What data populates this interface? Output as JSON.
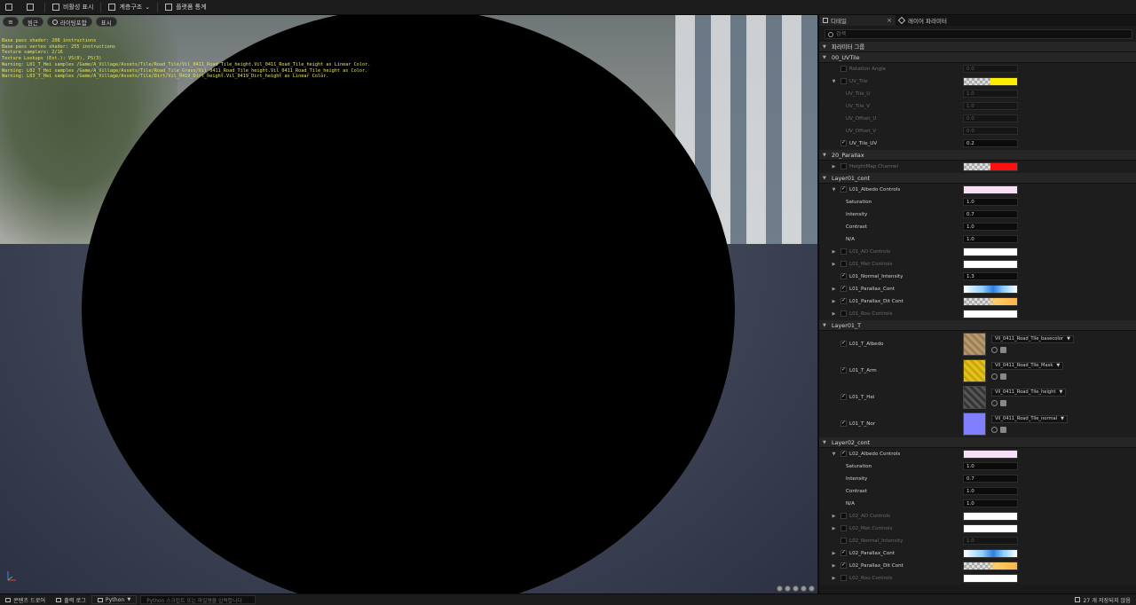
{
  "toolbar": {
    "save_icon": "save-icon",
    "items": [
      {
        "label": "비활성 표시",
        "icon": "hierarchy-icon"
      },
      {
        "label": "계층구조",
        "icon": "layers-icon",
        "dropdown": true
      },
      {
        "label": "플랫폼 통계",
        "icon": "stats-icon"
      }
    ]
  },
  "viewport": {
    "toolbar": {
      "menu_icon": "hamburger-icon",
      "perspective_label": "원근",
      "lit_label": "라이팅포함",
      "show_label": "표시"
    },
    "stats": [
      {
        "text": "Base pass shader: 208 instructions"
      },
      {
        "text": "Base pass vertex shader: 255 instructions"
      },
      {
        "text": "Texture samplers: 2/16"
      },
      {
        "text": "Texture Lookups (Est.): VS(0), PS(3)"
      },
      {
        "text": "Warning: L01_T_Hei samples /Game/A_Village/Assets/Tile/Road_Tile/Vil_0411_Road_Tile_height.Vil_0411_Road_Tile_height as Linear Color."
      },
      {
        "text": "Warning: L02_T_Hei samples /Game/A_Village/Assets/Tile/Road_Tile_Grass/Vil_0411_Road_Tile_height.Vil_0411_Road_Tile_height as Color."
      },
      {
        "text": "Warning: L03_T_Hei samples /Game/A_Village/Assets/Tile/Dirt/Vil_0419_Dirt_height.Vil_0419_Dirt_height as Linear Color."
      }
    ]
  },
  "panel": {
    "tabs": [
      {
        "label": "디테일",
        "close": "×"
      },
      {
        "label": "레이어 파라미터"
      }
    ],
    "search_placeholder": "검색",
    "parameter_group_label": "파라미터 그룹",
    "groups": [
      {
        "name": "00_UVTile",
        "rows": [
          {
            "label": "Rotation Angle",
            "dim": true,
            "checked": false,
            "expand": false,
            "type": "num",
            "value": "0.0",
            "vdim": true
          },
          {
            "label": "UV_Tile",
            "dim": true,
            "checked": false,
            "expand": true,
            "type": "swatch",
            "swatch": "checker-yellow"
          },
          {
            "label": "UV_Tile_U",
            "dim": true,
            "indent": true,
            "type": "num",
            "value": "1.0",
            "vdim": true
          },
          {
            "label": "UV_Tile_V",
            "dim": true,
            "indent": true,
            "type": "num",
            "value": "1.0",
            "vdim": true
          },
          {
            "label": "UV_Offset_U",
            "dim": true,
            "indent": true,
            "type": "num",
            "value": "0.0",
            "vdim": true
          },
          {
            "label": "UV_Offset_V",
            "dim": true,
            "indent": true,
            "type": "num",
            "value": "0.0",
            "vdim": true
          },
          {
            "label": "UV_Tile_UV",
            "checked": true,
            "expand": false,
            "type": "num",
            "value": "0.2"
          }
        ]
      },
      {
        "name": "20_Parallax",
        "rows": [
          {
            "label": "HeightMap Channel",
            "dim": true,
            "checked": false,
            "expand": true,
            "collapsed": true,
            "type": "swatch",
            "swatch": "checker-red"
          }
        ]
      },
      {
        "name": "Layer01_cont",
        "rows": [
          {
            "label": "L01_Albedo Controls",
            "checked": true,
            "expand": true,
            "type": "swatch",
            "swatch": "pink"
          },
          {
            "label": "Saturation",
            "indent": true,
            "type": "num",
            "value": "1.0"
          },
          {
            "label": "Intensity",
            "indent": true,
            "type": "num",
            "value": "0.7"
          },
          {
            "label": "Contrast",
            "indent": true,
            "type": "num",
            "value": "1.0"
          },
          {
            "label": "N/A",
            "indent": true,
            "type": "num",
            "value": "1.0"
          },
          {
            "label": "L01_AO Controls",
            "dim": true,
            "checked": false,
            "expand": true,
            "collapsed": true,
            "type": "swatch",
            "swatch": "white"
          },
          {
            "label": "L01_Met Controls",
            "dim": true,
            "checked": false,
            "expand": true,
            "collapsed": true,
            "type": "swatch",
            "swatch": "white"
          },
          {
            "label": "L01_Normal_Intensity",
            "checked": true,
            "expand": false,
            "type": "num",
            "value": "1.3"
          },
          {
            "label": "L01_Parallax_Cont",
            "checked": true,
            "expand": true,
            "collapsed": true,
            "type": "swatch",
            "swatch": "blue-grad"
          },
          {
            "label": "L01_Parallax_Dit Cont",
            "checked": true,
            "expand": true,
            "collapsed": true,
            "type": "swatch",
            "swatch": "checker-orange"
          },
          {
            "label": "L01_Rou Controls",
            "dim": true,
            "checked": false,
            "expand": true,
            "collapsed": true,
            "type": "swatch",
            "swatch": "white"
          }
        ]
      },
      {
        "name": "Layer01_T",
        "rows": [
          {
            "label": "L01_T_Albedo",
            "checked": true,
            "type": "tex",
            "tex": "albedo",
            "texname": "Vil_0411_Road_Tile_basecolor"
          },
          {
            "label": "L01_T_Arm",
            "checked": true,
            "type": "tex",
            "tex": "arm",
            "texname": "Vil_0411_Road_Tile_Mask"
          },
          {
            "label": "L01_T_Hei",
            "checked": true,
            "type": "tex",
            "tex": "hei",
            "texname": "Vil_0411_Road_Tile_height"
          },
          {
            "label": "L01_T_Nor",
            "checked": true,
            "type": "tex",
            "tex": "nor",
            "texname": "Vil_0411_Road_Tile_normal"
          }
        ]
      },
      {
        "name": "Layer02_cont",
        "rows": [
          {
            "label": "L02_Albedo Controls",
            "checked": true,
            "expand": true,
            "type": "swatch",
            "swatch": "pink"
          },
          {
            "label": "Saturation",
            "indent": true,
            "type": "num",
            "value": "1.0"
          },
          {
            "label": "Intensity",
            "indent": true,
            "type": "num",
            "value": "0.7"
          },
          {
            "label": "Contrast",
            "indent": true,
            "type": "num",
            "value": "1.0"
          },
          {
            "label": "N/A",
            "indent": true,
            "type": "num",
            "value": "1.0"
          },
          {
            "label": "L02_AO Controls",
            "dim": true,
            "checked": false,
            "expand": true,
            "collapsed": true,
            "type": "swatch",
            "swatch": "white"
          },
          {
            "label": "L02_Met Controls",
            "dim": true,
            "checked": false,
            "expand": true,
            "collapsed": true,
            "type": "swatch",
            "swatch": "white"
          },
          {
            "label": "L02_Normal_Intensity",
            "dim": true,
            "checked": false,
            "expand": false,
            "type": "num",
            "value": "1.0",
            "vdim": true
          },
          {
            "label": "L02_Parallax_Cont",
            "checked": true,
            "expand": true,
            "collapsed": true,
            "type": "swatch",
            "swatch": "blue-grad"
          },
          {
            "label": "L02_Parallax_Dit Cont",
            "checked": true,
            "expand": true,
            "collapsed": true,
            "type": "swatch",
            "swatch": "checker-orange"
          },
          {
            "label": "L02_Rou Controls",
            "dim": true,
            "checked": false,
            "expand": true,
            "collapsed": true,
            "type": "swatch",
            "swatch": "white"
          }
        ]
      }
    ]
  },
  "bottombar": {
    "content_drawer": "콘텐츠 드로어",
    "output_log": "출력 로그",
    "cmd_label": "Python",
    "cmd_placeholder": "Python 스크립트 또는 파일명을 입력합니다",
    "status": "27 개 저장되지 않음"
  },
  "colors": {
    "accent": "#e9e35c",
    "panel_bg": "#1a1a1a",
    "viewport_sphere": "#000000"
  }
}
